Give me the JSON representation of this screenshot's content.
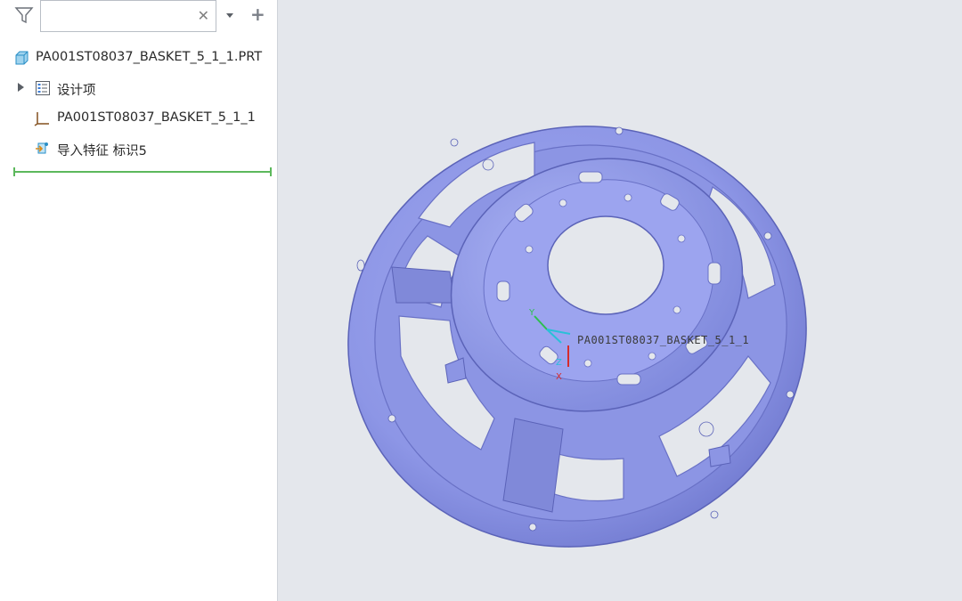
{
  "sidebar": {
    "search": {
      "value": "",
      "placeholder": ""
    },
    "icons": {
      "filter": "filter-icon",
      "clear": "close-icon",
      "dropdown": "chevron-down-icon",
      "add": "plus-icon"
    },
    "tree": [
      {
        "label": "PA001ST08037_BASKET_5_1_1.PRT",
        "icon": "part-icon",
        "expandable": false
      },
      {
        "label": "设计项",
        "icon": "design-items-icon",
        "expandable": true
      },
      {
        "label": "PA001ST08037_BASKET_5_1_1",
        "icon": "coordinate-system-icon",
        "expandable": false
      },
      {
        "label": "导入特征 标识5",
        "icon": "import-feature-icon",
        "expandable": false
      }
    ]
  },
  "viewport": {
    "model_label": "PA001ST08037_BASKET_5_1_1",
    "axes": {
      "x": "X",
      "y": "Y",
      "z": "Z"
    },
    "colors": {
      "part": "#8e97e8",
      "background": "#e4e7ec",
      "insert_line": "#5cb85c"
    }
  }
}
